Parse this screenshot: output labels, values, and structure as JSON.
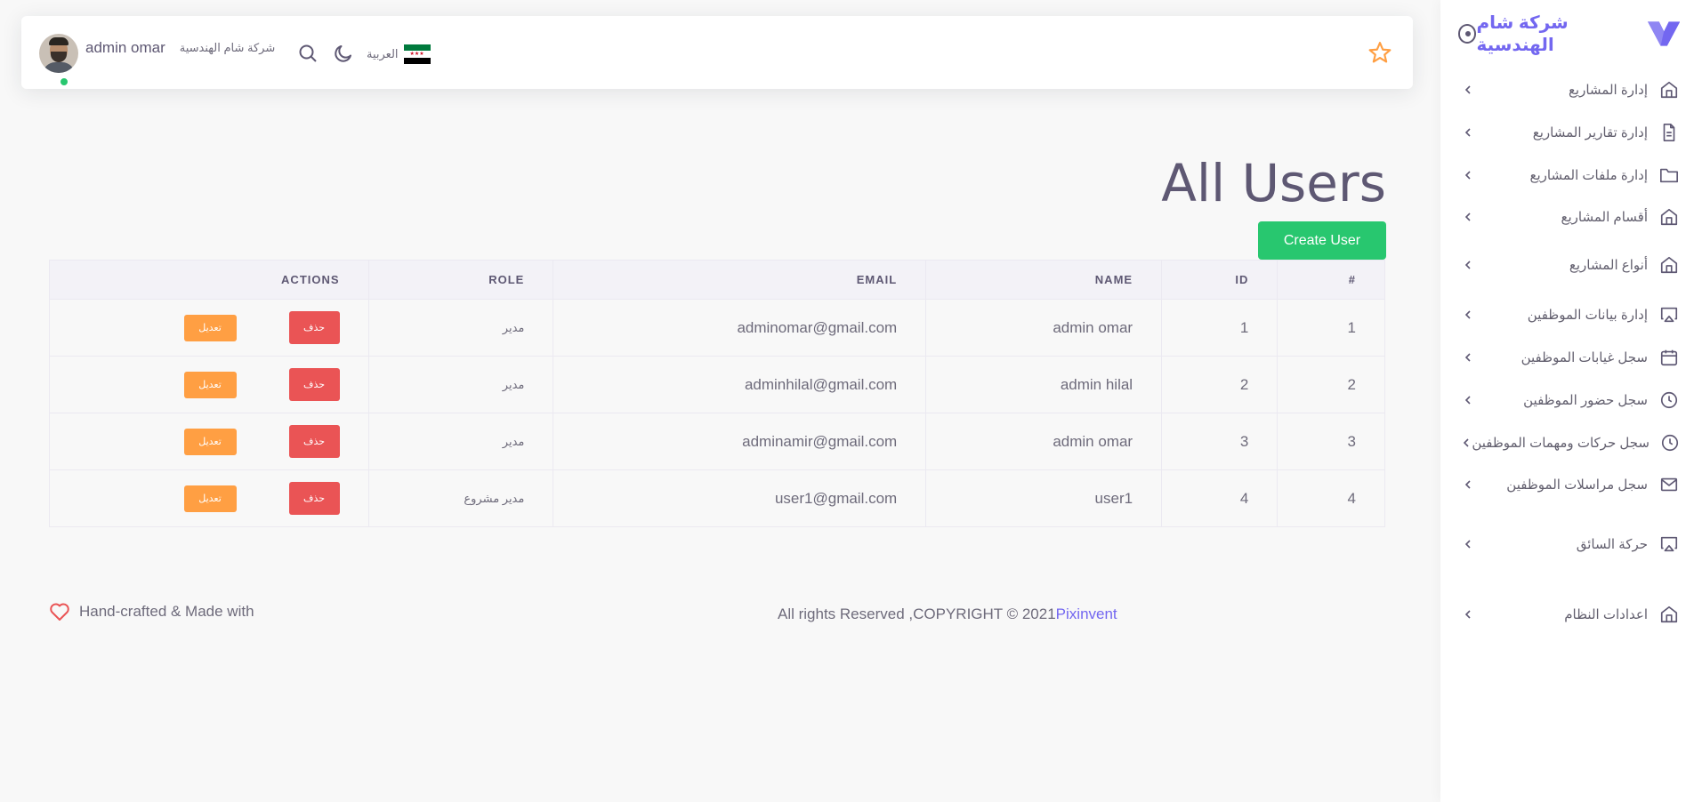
{
  "sidebar": {
    "brand_name": "شركة شام الهندسية",
    "items": [
      {
        "label": "إدارة المشاريع",
        "icon": "home-icon"
      },
      {
        "label": "إدارة تقارير المشاريع",
        "icon": "file-text-icon"
      },
      {
        "label": "إدارة ملفات المشاريع",
        "icon": "folder-icon"
      },
      {
        "label": "أقسام المشاريع",
        "icon": "home-icon"
      },
      {
        "label": "أنواع المشاريع",
        "icon": "home-icon"
      },
      {
        "label": "إدارة بيانات الموظفين",
        "icon": "airplay-icon"
      },
      {
        "label": "سجل غيابات الموظفين",
        "icon": "calendar-icon"
      },
      {
        "label": "سجل حضور الموظفين",
        "icon": "clock-icon"
      },
      {
        "label": "سجل حركات ومهمات الموظفين",
        "icon": "clock-icon"
      },
      {
        "label": "سجل مراسلات الموظفين",
        "icon": "mail-icon"
      },
      {
        "label": "حركة السائق",
        "icon": "airplay-icon"
      },
      {
        "label": "اعدادات النظام",
        "icon": "home-icon"
      }
    ]
  },
  "header": {
    "user_name": "admin omar",
    "company": "شركة شام الهندسية",
    "language": "العربية"
  },
  "main": {
    "title": "All Users",
    "create_button": "Create User",
    "columns": [
      "#",
      "ID",
      "NAME",
      "EMAIL",
      "ROLE",
      "ACTIONS"
    ],
    "rows": [
      {
        "index": "1",
        "id": "1",
        "name": "admin omar",
        "email": "adminomar@gmail.com",
        "role": "مدير"
      },
      {
        "index": "2",
        "id": "2",
        "name": "admin hilal",
        "email": "adminhilal@gmail.com",
        "role": "مدير"
      },
      {
        "index": "3",
        "id": "3",
        "name": "admin omar",
        "email": "adminamir@gmail.com",
        "role": "مدير"
      },
      {
        "index": "4",
        "id": "4",
        "name": "user1",
        "email": "user1@gmail.com",
        "role": "مدير مشروع"
      }
    ],
    "delete_label": "حذف",
    "edit_label": "تعديل"
  },
  "footer": {
    "copyright": "All rights Reserved ,COPYRIGHT © 2021",
    "link": "Pixinvent",
    "made_with": "Hand-crafted & Made with"
  },
  "colors": {
    "primary": "#7367f0",
    "success": "#28c76f",
    "danger": "#ea5455",
    "warning": "#ff9f43"
  }
}
